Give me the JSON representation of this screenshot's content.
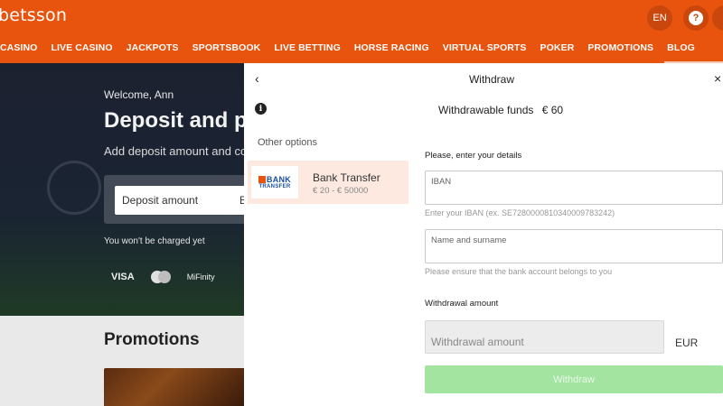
{
  "header": {
    "logo": "betsson",
    "lang": "EN",
    "help_icon": "?",
    "nav": [
      "CASINO",
      "LIVE CASINO",
      "JACKPOTS",
      "SPORTSBOOK",
      "LIVE BETTING",
      "HORSE RACING",
      "VIRTUAL SPORTS",
      "POKER",
      "PROMOTIONS",
      "BLOG"
    ]
  },
  "hero": {
    "welcome": "Welcome, Ann",
    "title": "Deposit and p",
    "subtitle": "Add deposit amount and cor",
    "deposit_placeholder": "Deposit amount",
    "deposit_suffix": "E",
    "no_charge": "You won't be charged yet",
    "payments": [
      "VISA",
      "MiFinity"
    ]
  },
  "promotions": {
    "title": "Promotions"
  },
  "modal": {
    "back_icon": "‹",
    "title": "Withdraw",
    "close_icon": "×",
    "info_icon": "i",
    "funds_label": "Withdrawable funds",
    "funds_amount": "€ 60",
    "other_options": "Other options",
    "bank_option": {
      "logo_line1": "BANK",
      "logo_line2": "TRANSFER",
      "name": "Bank Transfer",
      "range": "€ 20 - € 50000"
    },
    "details_label": "Please, enter your details",
    "iban": {
      "label": "IBAN",
      "hint": "Enter your IBAN (ex. SE7280000810340009783242)"
    },
    "name": {
      "label": "Name and surname",
      "hint": "Please ensure that the bank account belongs to you"
    },
    "amount_label": "Withdrawal amount",
    "amount_placeholder": "Withdrawal amount",
    "currency": "EUR",
    "withdraw_button": "Withdraw"
  },
  "colors": {
    "brand_orange": "#e8530e",
    "selected_option_bg": "#fde9df",
    "withdraw_button_disabled": "#a3e4a1"
  }
}
